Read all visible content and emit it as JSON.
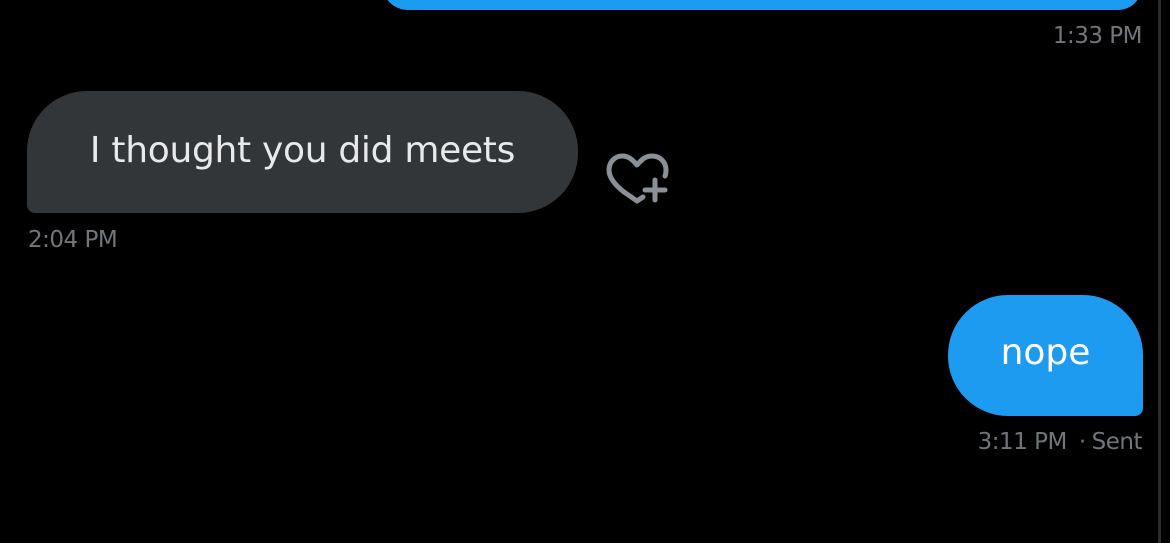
{
  "colors": {
    "background": "#000000",
    "sent_bubble": "#1d9bf0",
    "received_bubble": "#333639",
    "timestamp": "#71767b",
    "received_text": "#e7e9ea",
    "sent_text": "#ffffff",
    "icon": "#8b9096"
  },
  "conversation": {
    "messages": [
      {
        "direction": "sent",
        "text": "",
        "timestamp": "1:33 PM",
        "status": ""
      },
      {
        "direction": "received",
        "text": "I thought you did meets",
        "timestamp": "2:04 PM",
        "reaction_icon": "heart-plus-icon"
      },
      {
        "direction": "sent",
        "text": "nope",
        "timestamp": "3:11 PM",
        "separator": "·",
        "status": "Sent"
      }
    ]
  }
}
